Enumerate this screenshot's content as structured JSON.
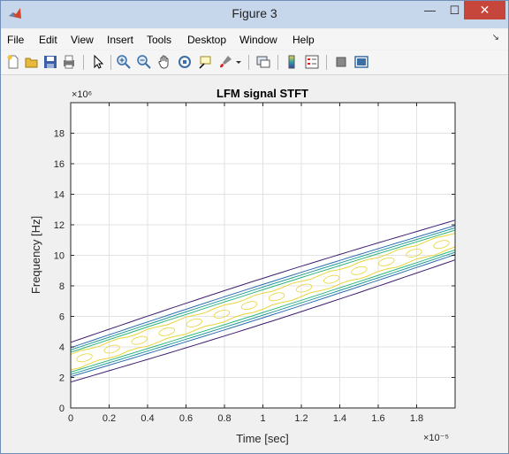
{
  "window": {
    "title": "Figure 3",
    "minimize": "—",
    "maximize": "☐",
    "close": "✕"
  },
  "menu": [
    "File",
    "Edit",
    "View",
    "Insert",
    "Tools",
    "Desktop",
    "Window",
    "Help"
  ],
  "menu_extra_glyph": "↘",
  "toolbar_icons": [
    "new-figure-icon",
    "open-file-icon",
    "save-icon",
    "print-icon",
    "pointer-icon",
    "zoom-in-icon",
    "zoom-out-icon",
    "pan-icon",
    "rotate-icon",
    "data-cursor-icon",
    "brush-icon",
    "brush-dropdown-icon",
    "link-plot-icon",
    "colorbar-icon",
    "legend-icon",
    "hide-plot-tools-icon",
    "show-plot-tools-icon"
  ],
  "chart_data": {
    "type": "contour",
    "title": "LFM signal STFT",
    "xlabel": "Time [sec]",
    "ylabel": "Frequency [Hz]",
    "x_exponent_label": "×10⁻⁵",
    "y_exponent_label": "×10⁶",
    "xlim": [
      0,
      2e-05
    ],
    "ylim": [
      0,
      20000000.0
    ],
    "x_ticks": [
      0,
      0.2,
      0.4,
      0.6,
      0.8,
      1,
      1.2,
      1.4,
      1.6,
      1.8
    ],
    "x_tick_labels": [
      "0",
      "0.2",
      "0.4",
      "0.6",
      "0.8",
      "1",
      "1.2",
      "1.4",
      "1.6",
      "1.8"
    ],
    "y_ticks": [
      0,
      2,
      4,
      6,
      8,
      10,
      12,
      14,
      16,
      18
    ],
    "y_tick_labels": [
      "0",
      "2",
      "4",
      "6",
      "8",
      "10",
      "12",
      "14",
      "16",
      "18"
    ],
    "grid": true,
    "ridge": {
      "t_sec": [
        0,
        2e-05
      ],
      "f_hz": [
        3000000.0,
        11000000.0
      ]
    },
    "contour_halfwidths_hz": [
      1300000.0,
      950000.0,
      800000.0,
      650000.0,
      500000.0
    ],
    "colors": [
      "#3e1e6e",
      "#2f6db0",
      "#1f9a9a",
      "#2cb47a",
      "#e8d43a"
    ]
  }
}
